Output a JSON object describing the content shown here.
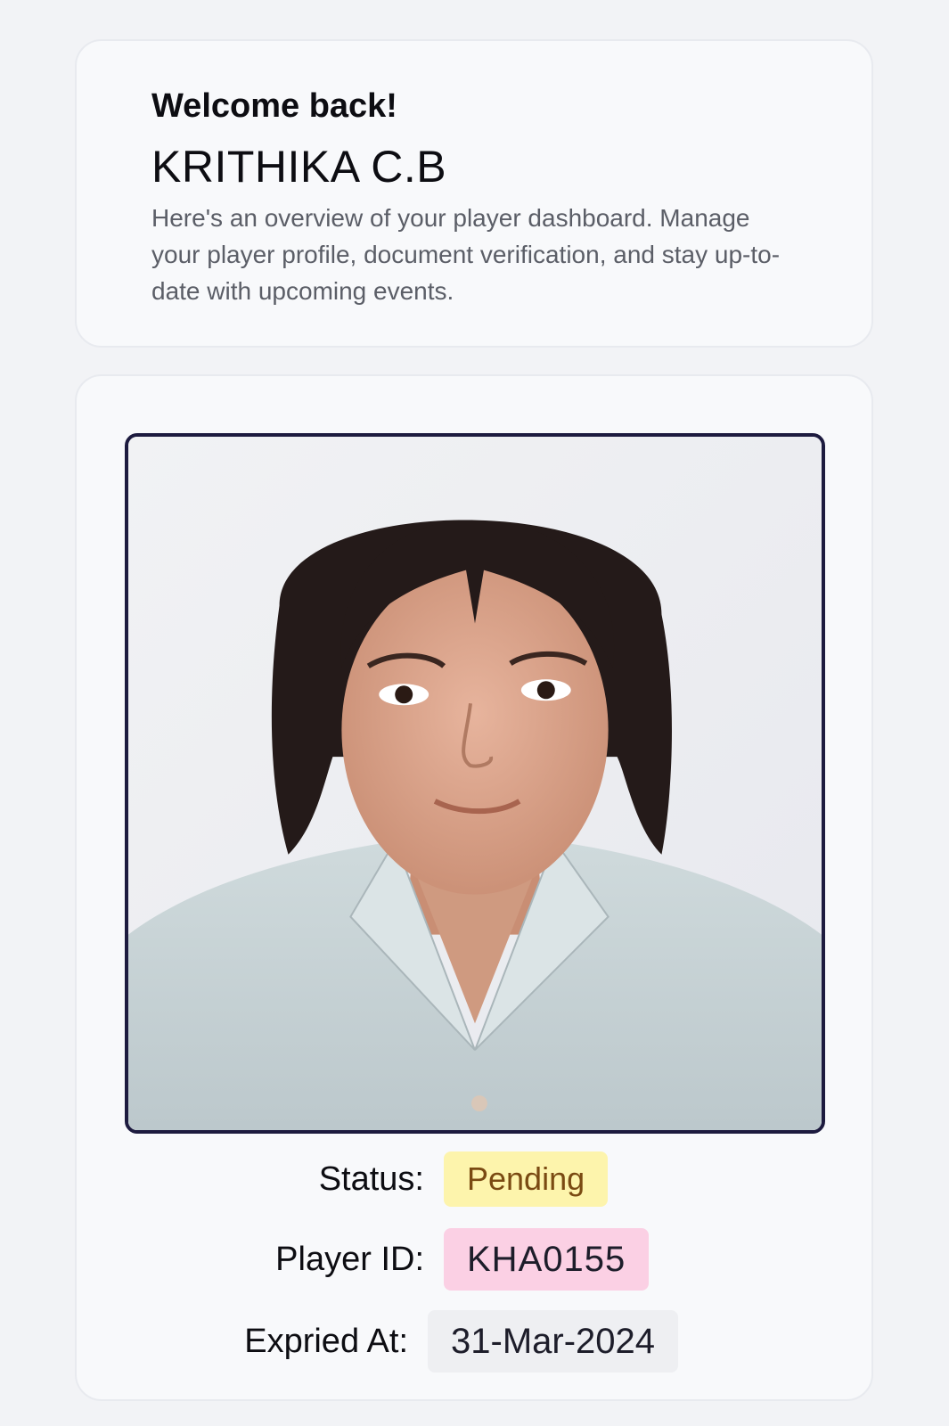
{
  "welcome": {
    "title": "Welcome back!",
    "name": "KRITHIKA C.B",
    "description": "Here's an overview of your player dashboard. Manage your player profile, document verification, and stay up-to-date with upcoming events."
  },
  "profile": {
    "status_label": "Status:",
    "status_value": "Pending",
    "player_id_label": "Player ID:",
    "player_id_value": "KHA0155",
    "expired_label": "Expried At:",
    "expired_value": "31-Mar-2024"
  },
  "colors": {
    "page_background": "#f2f3f6",
    "card_background": "#f8f9fb",
    "photo_border": "#1d1b3f",
    "status_pill": "#fdf4ac",
    "status_text": "#7a4a12",
    "player_id_pill": "#fbd0e4",
    "expired_pill": "#eeeff2"
  }
}
